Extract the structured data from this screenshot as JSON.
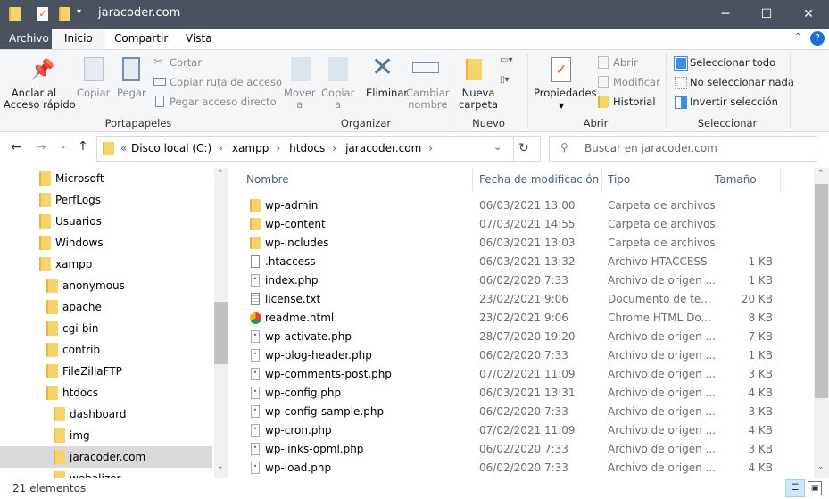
{
  "window": {
    "title": "jaracoder.com",
    "minimize": "─",
    "maximize": "☐",
    "close": "✕"
  },
  "tabs": [
    "Archivo",
    "Inicio",
    "Compartir",
    "Vista"
  ],
  "ribbon": {
    "portapapeles": {
      "label": "Portapapeles",
      "pin": "Anclar al\nAcceso rápido",
      "copy": "Copiar",
      "paste": "Pegar",
      "cut": "Cortar",
      "copy_path": "Copiar ruta de acceso",
      "paste_shortcut": "Pegar acceso directo"
    },
    "organizar": {
      "label": "Organizar",
      "move": "Mover\na",
      "copy_to": "Copiar\na",
      "delete": "Eliminar",
      "rename": "Cambiar\nnombre"
    },
    "nuevo": {
      "label": "Nuevo",
      "new_folder": "Nueva\ncarpeta"
    },
    "abrir": {
      "label": "Abrir",
      "properties": "Propiedades",
      "open": "Abrir",
      "edit": "Modificar",
      "history": "Historial"
    },
    "seleccionar": {
      "label": "Seleccionar",
      "all": "Seleccionar todo",
      "none": "No seleccionar nada",
      "invert": "Invertir selección"
    }
  },
  "address": {
    "prefix": "«",
    "crumbs": [
      "Disco local (C:)",
      "xampp",
      "htdocs",
      "jaracoder.com"
    ]
  },
  "search": {
    "placeholder": "Buscar en jaracoder.com"
  },
  "nav": [
    {
      "label": "Microsoft",
      "level": 0
    },
    {
      "label": "PerfLogs",
      "level": 0
    },
    {
      "label": "Usuarios",
      "level": 0
    },
    {
      "label": "Windows",
      "level": 0
    },
    {
      "label": "xampp",
      "level": 0
    },
    {
      "label": "anonymous",
      "level": 1
    },
    {
      "label": "apache",
      "level": 1
    },
    {
      "label": "cgi-bin",
      "level": 1
    },
    {
      "label": "contrib",
      "level": 1
    },
    {
      "label": "FileZillaFTP",
      "level": 1
    },
    {
      "label": "htdocs",
      "level": 1
    },
    {
      "label": "dashboard",
      "level": 2
    },
    {
      "label": "img",
      "level": 2
    },
    {
      "label": "jaracoder.com",
      "level": 2,
      "selected": true
    },
    {
      "label": "webalizer",
      "level": 2
    }
  ],
  "columns": {
    "name": "Nombre",
    "date": "Fecha de modificación",
    "type": "Tipo",
    "size": "Tamaño"
  },
  "files": [
    {
      "name": "wp-admin",
      "date": "06/03/2021 13:00",
      "type": "Carpeta de archivos",
      "size": "",
      "icon": "folder"
    },
    {
      "name": "wp-content",
      "date": "07/03/2021 14:55",
      "type": "Carpeta de archivos",
      "size": "",
      "icon": "folder"
    },
    {
      "name": "wp-includes",
      "date": "06/03/2021 13:03",
      "type": "Carpeta de archivos",
      "size": "",
      "icon": "folder"
    },
    {
      "name": ".htaccess",
      "date": "06/03/2021 13:32",
      "type": "Archivo HTACCESS",
      "size": "1 KB",
      "icon": "file"
    },
    {
      "name": "index.php",
      "date": "06/02/2020 7:33",
      "type": "Archivo de origen ...",
      "size": "1 KB",
      "icon": "php"
    },
    {
      "name": "license.txt",
      "date": "23/02/2021 9:06",
      "type": "Documento de te...",
      "size": "20 KB",
      "icon": "txt"
    },
    {
      "name": "readme.html",
      "date": "23/02/2021 9:06",
      "type": "Chrome HTML Do...",
      "size": "8 KB",
      "icon": "chrome"
    },
    {
      "name": "wp-activate.php",
      "date": "28/07/2020 19:20",
      "type": "Archivo de origen ...",
      "size": "7 KB",
      "icon": "php"
    },
    {
      "name": "wp-blog-header.php",
      "date": "06/02/2020 7:33",
      "type": "Archivo de origen ...",
      "size": "1 KB",
      "icon": "php"
    },
    {
      "name": "wp-comments-post.php",
      "date": "07/02/2021 11:09",
      "type": "Archivo de origen ...",
      "size": "3 KB",
      "icon": "php"
    },
    {
      "name": "wp-config.php",
      "date": "06/03/2021 13:31",
      "type": "Archivo de origen ...",
      "size": "4 KB",
      "icon": "php"
    },
    {
      "name": "wp-config-sample.php",
      "date": "06/02/2020 7:33",
      "type": "Archivo de origen ...",
      "size": "3 KB",
      "icon": "php"
    },
    {
      "name": "wp-cron.php",
      "date": "07/02/2021 11:09",
      "type": "Archivo de origen ...",
      "size": "4 KB",
      "icon": "php"
    },
    {
      "name": "wp-links-opml.php",
      "date": "06/02/2020 7:33",
      "type": "Archivo de origen ...",
      "size": "3 KB",
      "icon": "php"
    },
    {
      "name": "wp-load.php",
      "date": "06/02/2020 7:33",
      "type": "Archivo de origen ...",
      "size": "4 KB",
      "icon": "php"
    }
  ],
  "status": {
    "count": "21 elementos"
  }
}
